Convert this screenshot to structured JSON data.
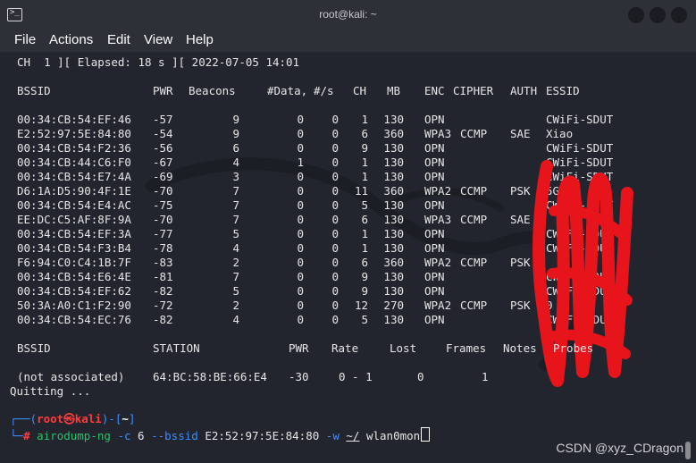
{
  "window": {
    "title": "root@kali: ~",
    "icon": "terminal-icon"
  },
  "menu": [
    "File",
    "Actions",
    "Edit",
    "View",
    "Help"
  ],
  "status_line": "CH  1 ][ Elapsed: 18 s ][ 2022-07-05 14:01",
  "ap_headers": [
    "BSSID",
    "PWR",
    "Beacons",
    "#Data,",
    "#/s",
    "CH",
    "MB",
    "ENC",
    "CIPHER",
    "AUTH",
    "ESSID"
  ],
  "ap_rows": [
    {
      "bssid": "00:34:CB:54:EF:46",
      "pwr": "-57",
      "beacons": "9",
      "data": "0",
      "ps": "0",
      "ch": "1",
      "mb": "130",
      "enc": "OPN",
      "cipher": "",
      "auth": "",
      "essid": "CWiFi-SDUT"
    },
    {
      "bssid": "E2:52:97:5E:84:80",
      "pwr": "-54",
      "beacons": "9",
      "data": "0",
      "ps": "0",
      "ch": "6",
      "mb": "360",
      "enc": "WPA3",
      "cipher": "CCMP",
      "auth": "SAE",
      "essid": "Xiao"
    },
    {
      "bssid": "00:34:CB:54:F2:36",
      "pwr": "-56",
      "beacons": "6",
      "data": "0",
      "ps": "0",
      "ch": "9",
      "mb": "130",
      "enc": "OPN",
      "cipher": "",
      "auth": "",
      "essid": "CWiFi-SDUT"
    },
    {
      "bssid": "00:34:CB:44:C6:F0",
      "pwr": "-67",
      "beacons": "4",
      "data": "1",
      "ps": "0",
      "ch": "1",
      "mb": "130",
      "enc": "OPN",
      "cipher": "",
      "auth": "",
      "essid": "CWiFi-SDUT"
    },
    {
      "bssid": "00:34:CB:54:E7:4A",
      "pwr": "-69",
      "beacons": "3",
      "data": "0",
      "ps": "0",
      "ch": "1",
      "mb": "130",
      "enc": "OPN",
      "cipher": "",
      "auth": "",
      "essid": "CWiFi-SDUT"
    },
    {
      "bssid": "D6:1A:D5:90:4F:1E",
      "pwr": "-70",
      "beacons": "7",
      "data": "0",
      "ps": "0",
      "ch": "11",
      "mb": "360",
      "enc": "WPA2",
      "cipher": "CCMP",
      "auth": "PSK",
      "essid": "5G"
    },
    {
      "bssid": "00:34:CB:54:E4:AC",
      "pwr": "-75",
      "beacons": "7",
      "data": "0",
      "ps": "0",
      "ch": "5",
      "mb": "130",
      "enc": "OPN",
      "cipher": "",
      "auth": "",
      "essid": "CWiFi-SDUT"
    },
    {
      "bssid": "EE:DC:C5:AF:8F:9A",
      "pwr": "-70",
      "beacons": "7",
      "data": "0",
      "ps": "0",
      "ch": "6",
      "mb": "130",
      "enc": "WPA3",
      "cipher": "CCMP",
      "auth": "SAE",
      "essid": ""
    },
    {
      "bssid": "00:34:CB:54:EF:3A",
      "pwr": "-77",
      "beacons": "5",
      "data": "0",
      "ps": "0",
      "ch": "1",
      "mb": "130",
      "enc": "OPN",
      "cipher": "",
      "auth": "",
      "essid": "CWiFi-SDUT"
    },
    {
      "bssid": "00:34:CB:54:F3:B4",
      "pwr": "-78",
      "beacons": "4",
      "data": "0",
      "ps": "0",
      "ch": "1",
      "mb": "130",
      "enc": "OPN",
      "cipher": "",
      "auth": "",
      "essid": "CWiFi-SDUT"
    },
    {
      "bssid": "F6:94:C0:C4:1B:7F",
      "pwr": "-83",
      "beacons": "2",
      "data": "0",
      "ps": "0",
      "ch": "6",
      "mb": "360",
      "enc": "WPA2",
      "cipher": "CCMP",
      "auth": "PSK",
      "essid": ""
    },
    {
      "bssid": "00:34:CB:54:E6:4E",
      "pwr": "-81",
      "beacons": "7",
      "data": "0",
      "ps": "0",
      "ch": "9",
      "mb": "130",
      "enc": "OPN",
      "cipher": "",
      "auth": "",
      "essid": "CWiFi-SDUT"
    },
    {
      "bssid": "00:34:CB:54:EF:62",
      "pwr": "-82",
      "beacons": "5",
      "data": "0",
      "ps": "0",
      "ch": "9",
      "mb": "130",
      "enc": "OPN",
      "cipher": "",
      "auth": "",
      "essid": "CWiFi-SDUT"
    },
    {
      "bssid": "50:3A:A0:C1:F2:90",
      "pwr": "-72",
      "beacons": "2",
      "data": "0",
      "ps": "0",
      "ch": "12",
      "mb": "270",
      "enc": "WPA2",
      "cipher": "CCMP",
      "auth": "PSK",
      "essid": "0"
    },
    {
      "bssid": "00:34:CB:54:EC:76",
      "pwr": "-82",
      "beacons": "4",
      "data": "0",
      "ps": "0",
      "ch": "5",
      "mb": "130",
      "enc": "OPN",
      "cipher": "",
      "auth": "",
      "essid": "CWiFi-SDUT"
    }
  ],
  "sta_headers": [
    "BSSID",
    "STATION",
    "PWR",
    "Rate",
    "Lost",
    "Frames",
    "Notes",
    "Probes"
  ],
  "sta_rows": [
    {
      "bssid": "(not associated)",
      "station": "64:BC:58:BE:66:E4",
      "pwr": "-30",
      "rate": "0 - 1",
      "lost": "0",
      "frames": "1"
    }
  ],
  "quit_line": "Quitting ...",
  "prompt": {
    "user": "root",
    "at": "㉿",
    "host": "kali",
    "dir": "~",
    "symbol": "#",
    "cmd": "airodump-ng",
    "flag_c": "-c",
    "channel": "6",
    "flag_bssid": "--bssid",
    "bssid": "E2:52:97:5E:84:80",
    "flag_w": "-w",
    "path": "~/",
    "iface": "wlan0mon"
  },
  "watermark": "CSDN @xyz_CDragon",
  "colors": {
    "bg": "#23252e",
    "titlebar": "#2e3038",
    "prompt_blue": "#3a8fff",
    "prompt_red": "#ff3b3b",
    "cmd_green": "#2fbf6a",
    "scribble": "#e8141c"
  }
}
